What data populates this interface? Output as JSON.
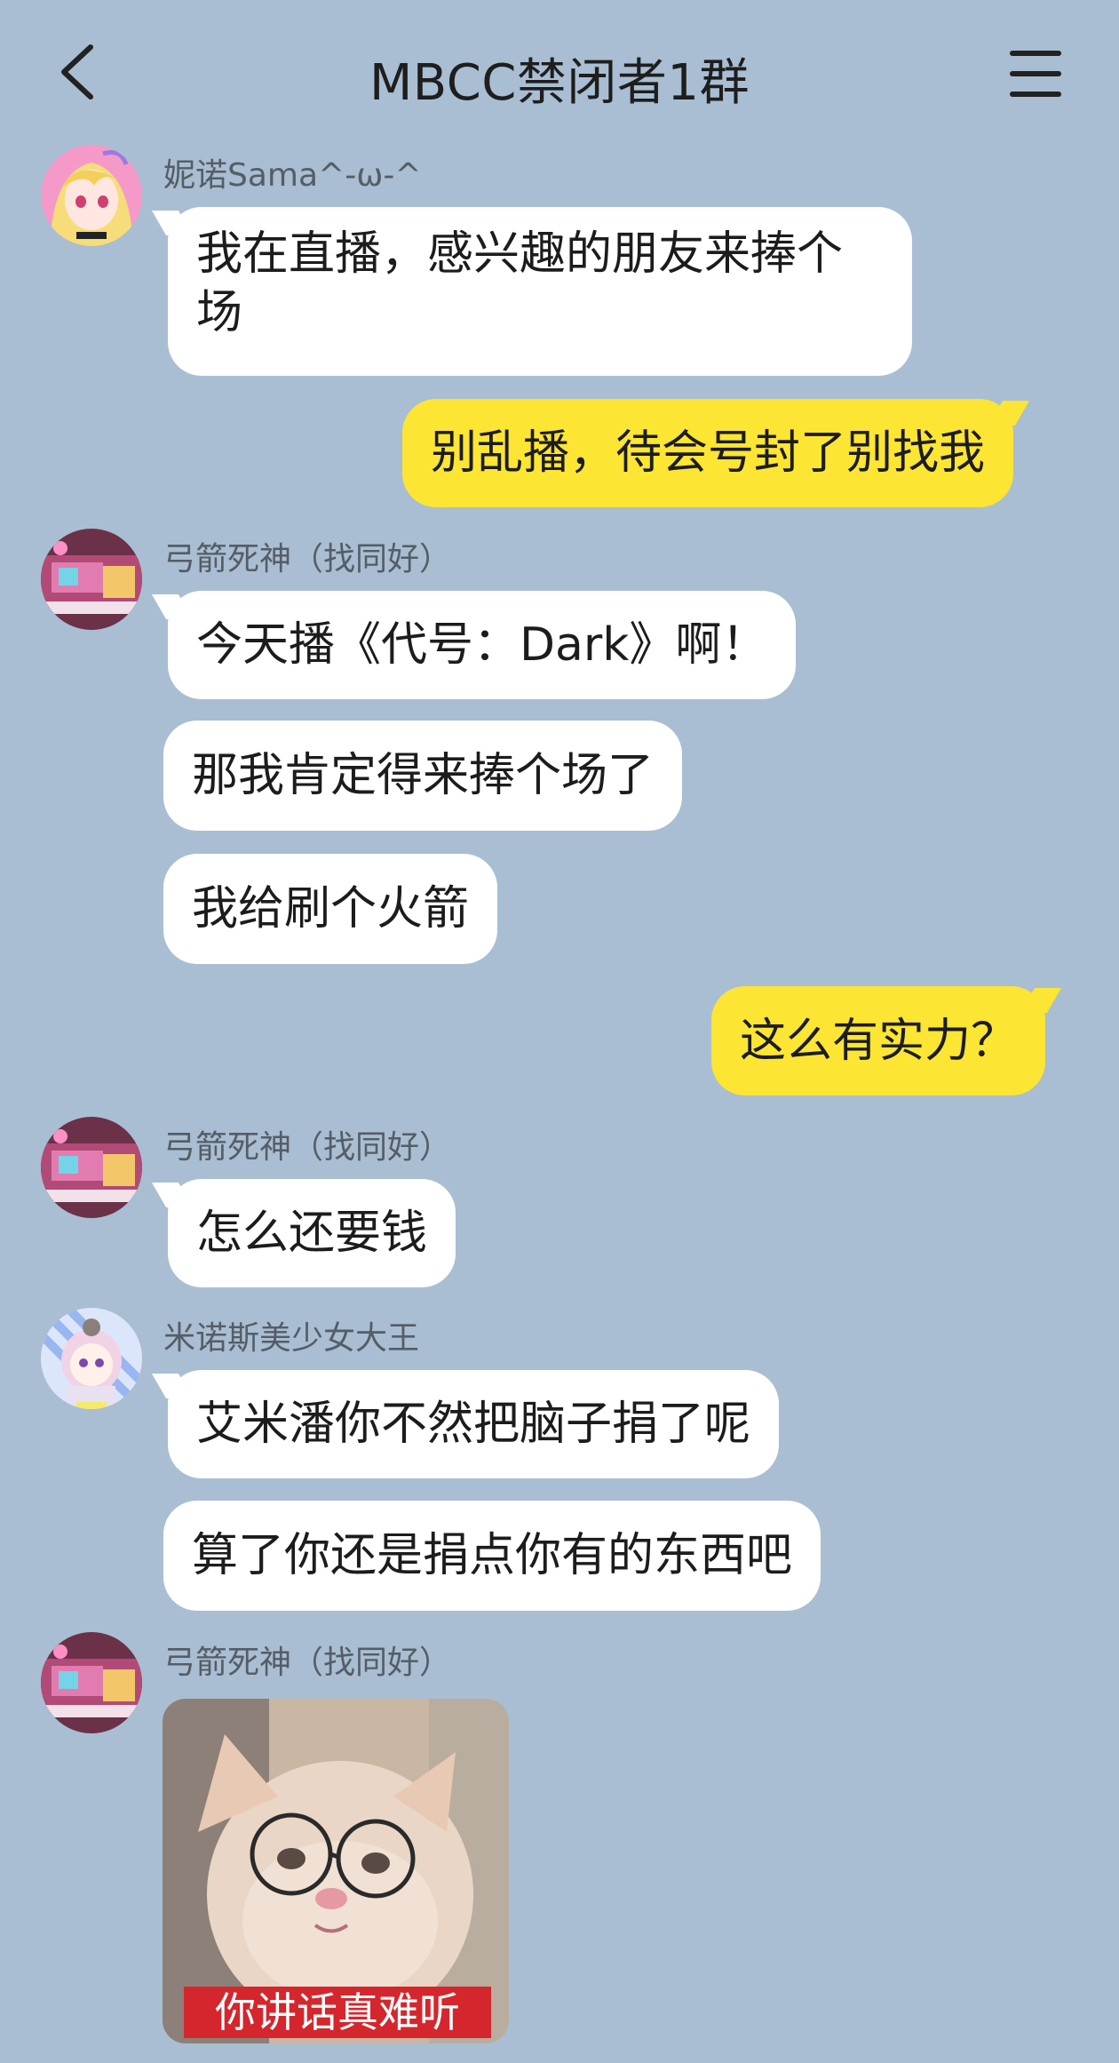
{
  "header": {
    "title": "MBCC禁闭者1群",
    "back_icon": "chevron-left-icon",
    "menu_icon": "hamburger-menu-icon"
  },
  "colors": {
    "background": "#a9bed2",
    "incoming_bubble": "#ffffff",
    "outgoing_bubble": "#fce533",
    "sticker_caption_bg": "#d5262d"
  },
  "messages": [
    {
      "sender": "妮诺Sama^-ω-^",
      "text": "我在直播，感兴趣的朋友来捧个场"
    },
    {
      "sender": "me",
      "text": "别乱播，待会号封了别找我"
    },
    {
      "sender": "弓箭死神（找同好）",
      "text": "今天播《代号：Dark》啊！"
    },
    {
      "sender": "弓箭死神（找同好）",
      "text": "那我肯定得来捧个场了"
    },
    {
      "sender": "弓箭死神（找同好）",
      "text": "我给刷个火箭"
    },
    {
      "sender": "me",
      "text": "这么有实力？"
    },
    {
      "sender": "弓箭死神（找同好）",
      "text": "怎么还要钱"
    },
    {
      "sender": "米诺斯美少女大王",
      "text": "艾米潘你不然把脑子捐了呢"
    },
    {
      "sender": "米诺斯美少女大王",
      "text": "算了你还是捐点你有的东西吧"
    },
    {
      "sender": "弓箭死神（找同好）",
      "sticker_caption": "你讲话真难听"
    }
  ]
}
